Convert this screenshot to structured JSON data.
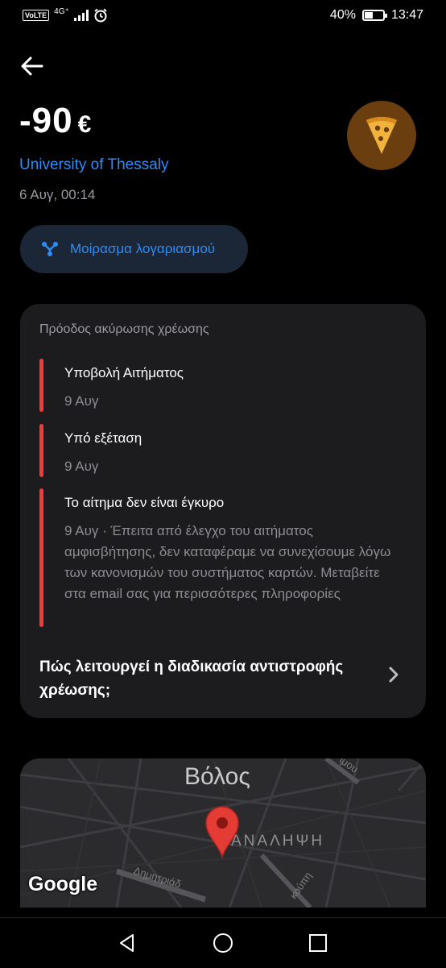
{
  "status_bar": {
    "volte": "VoLTE",
    "network": "4G⁺",
    "battery_percent": "40%",
    "time": "13:47",
    "icons": [
      "volte-icon",
      "signal-icon",
      "alarm-icon",
      "battery-icon"
    ]
  },
  "header": {
    "back_icon": "arrow-left-icon"
  },
  "transaction": {
    "amount": "-90",
    "currency": "€",
    "merchant": "University of Thessaly",
    "datetime": "6 Αυγ, 00:14",
    "avatar_icon": "pizza-icon",
    "avatar_color": "#6b3e10"
  },
  "split_button": {
    "label": "Μοίρασμα λογαριασμού",
    "icon": "split-icon"
  },
  "chargeback": {
    "title": "Πρόοδος ακύρωσης χρέωσης",
    "accent": "#ee3b3b",
    "steps": [
      {
        "title": "Υποβολή Αιτήματος",
        "sub": "9 Αυγ"
      },
      {
        "title": "Υπό εξέταση",
        "sub": "9 Αυγ"
      },
      {
        "title": "Το αίτημα δεν είναι έγκυρο",
        "sub": "9 Αυγ · Έπειτα από έλεγχο του αιτήματος αμφισβήτησης, δεν καταφέραμε να συνεχίσουμε λόγω των κανονισμών του συστήματος καρτών. Μεταβείτε στα email σας για περισσότερες πληροφορίες"
      }
    ],
    "how_link": "Πώς λειτουργεί η διαδικασία αντιστροφής χρέωσης;"
  },
  "map": {
    "city": "Βόλος",
    "area": "ΑΝΑΛΗΨΗ",
    "road_1": "Δημητριάδ",
    "road_2": "κούπη",
    "road_3": "ιμου",
    "attribution": "Google"
  },
  "nav": {
    "back": "triangle-back-icon",
    "home": "circle-home-icon",
    "recents": "square-recents-icon"
  },
  "colors": {
    "link": "#2f8cf5",
    "card": "#1c1c1e",
    "button_bg": "#1b2636"
  }
}
